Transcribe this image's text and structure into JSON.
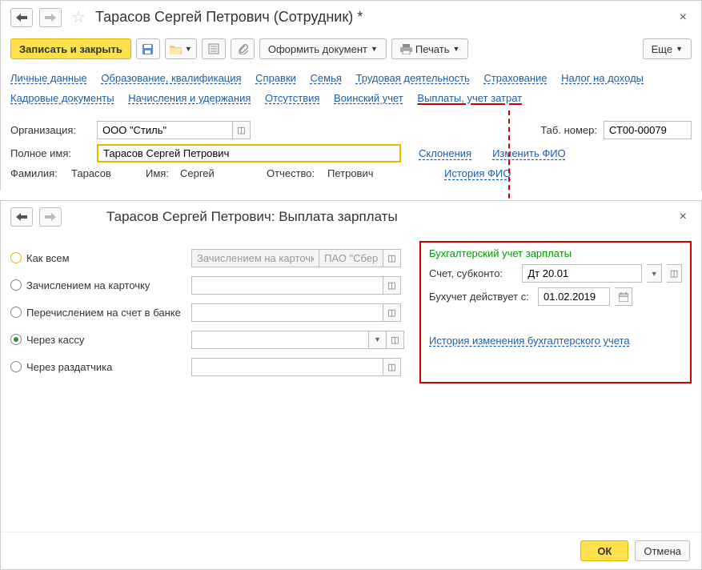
{
  "topWindow": {
    "title": "Тарасов Сергей Петрович (Сотрудник) *",
    "toolbar": {
      "saveClose": "Записать и закрыть",
      "formatDoc": "Оформить документ",
      "print": "Печать",
      "more": "Еще"
    },
    "linksRow1": [
      "Личные данные",
      "Образование, квалификация",
      "Справки",
      "Семья",
      "Трудовая деятельность",
      "Страхование",
      "Налог на доходы"
    ],
    "linksRow2": [
      "Кадровые документы",
      "Начисления и удержания",
      "Отсутствия",
      "Воинский учет",
      "Выплаты, учет затрат"
    ],
    "activeLink": "Выплаты, учет затрат",
    "org": {
      "label": "Организация:",
      "value": "ООО \"Стиль\""
    },
    "tabNum": {
      "label": "Таб. номер:",
      "value": "СТ00-00079"
    },
    "fullName": {
      "label": "Полное имя:",
      "value": "Тарасов Сергей Петрович"
    },
    "declension": "Склонения",
    "changeFio": "Изменить ФИО",
    "surname": {
      "label": "Фамилия:",
      "value": "Тарасов"
    },
    "name": {
      "label": "Имя:",
      "value": "Сергей"
    },
    "patronymic": {
      "label": "Отчество:",
      "value": "Петрович"
    },
    "fioHistory": "История ФИО"
  },
  "subWindow": {
    "title": "Тарасов Сергей Петрович: Выплата зарплаты",
    "options": {
      "kakVsem": "Как всем",
      "card": "Зачислением на карточку",
      "bank": "Перечислением на счет в банке",
      "cash": "Через кассу",
      "distributor": "Через раздатчика"
    },
    "disabledField1": "Зачислением на карточку",
    "disabledField2": "ПАО \"Сберб",
    "accounting": {
      "title": "Бухгалтерский учет зарплаты",
      "accountLabel": "Счет, субконто:",
      "accountValue": "Дт 20.01",
      "fromLabel": "Бухучет действует с:",
      "fromValue": "01.02.2019",
      "historyLink": "История изменения бухгалтерского учета"
    },
    "footer": {
      "ok": "ОК",
      "cancel": "Отмена"
    }
  }
}
